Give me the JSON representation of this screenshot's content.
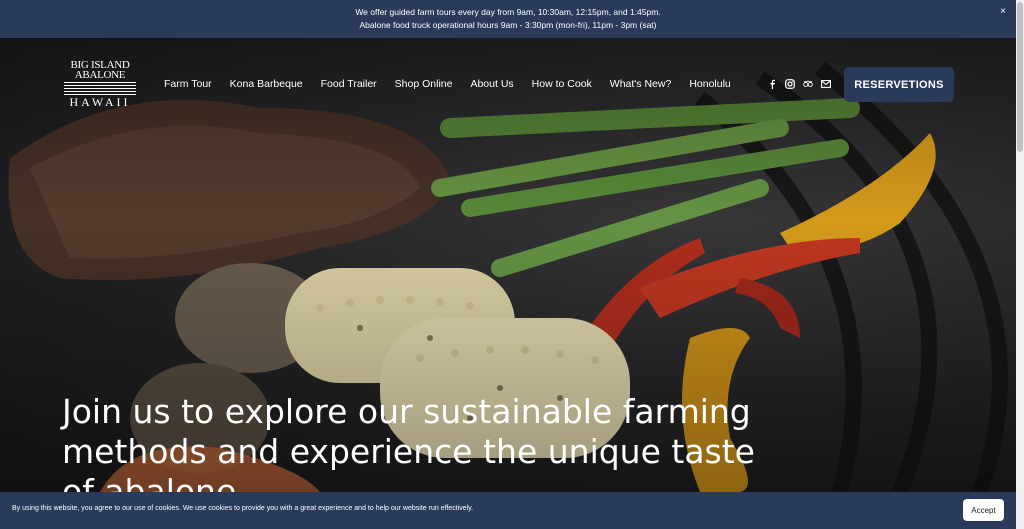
{
  "announcement": {
    "line1": "We offer guided farm tours every day from 9am, 10:30am, 12:15pm, and 1:45pm.",
    "line2": "Abalone food truck operational hours 9am - 3:30pm (mon-fri), 11pm - 3pm (sat)",
    "close_label": "×"
  },
  "logo": {
    "line1": "BIG ISLAND",
    "line2": "ABALONE",
    "line3": "HAWAII"
  },
  "nav": {
    "items": [
      {
        "label": "Farm Tour"
      },
      {
        "label": "Kona Barbeque"
      },
      {
        "label": "Food Trailer"
      },
      {
        "label": "Shop Online"
      },
      {
        "label": "About Us"
      },
      {
        "label": "How to Cook"
      },
      {
        "label": "What's New?"
      },
      {
        "label": "Honolulu"
      }
    ]
  },
  "social": {
    "icons": [
      "facebook-icon",
      "instagram-icon",
      "tripadvisor-icon",
      "email-icon"
    ]
  },
  "reservations_label": "RESERVETIONS",
  "hero": {
    "headline": "Join us to explore our sustainable farming methods and experience the unique taste of abalone."
  },
  "cookie": {
    "message": "By using this website, you agree to our use of cookies. We use cookies to provide you with a great experience and to help our website run effectively.",
    "accept_label": "Accept"
  }
}
